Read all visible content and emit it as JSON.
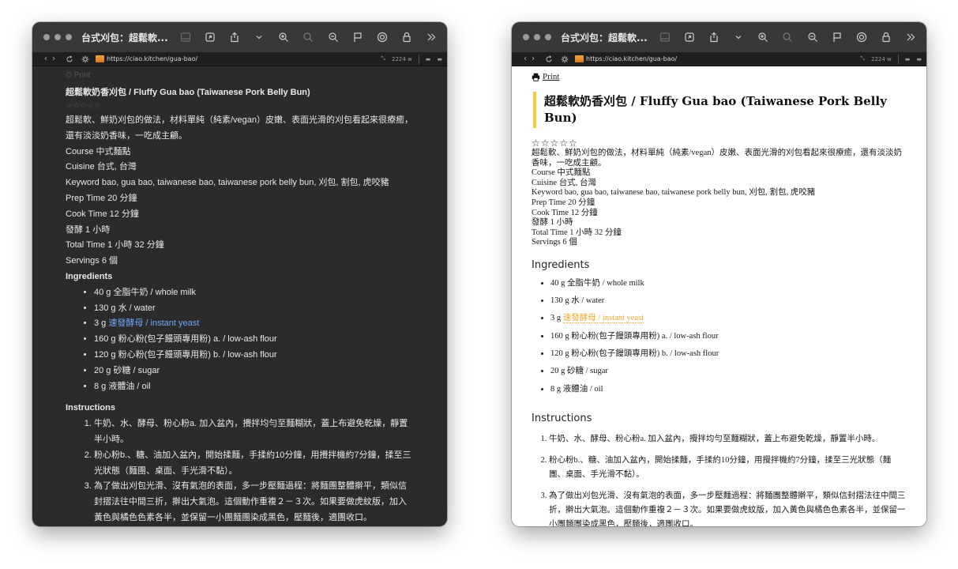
{
  "window": {
    "title": "台式刈包：超鬆軟...",
    "url": "https://ciao.kitchen/gua-bao/",
    "width_badge": "2224 w"
  },
  "recipe": {
    "print_label": "Print",
    "title_dark": "超鬆軟奶香刈包 / Fluffy Gua bao (Taiwanese Pork Belly Bun)",
    "title_light": "超鬆軟奶香刈包 / Fluffy Gua bao (Taiwanese Pork Belly Bun)",
    "stars": "☆☆☆☆☆",
    "description": "超鬆軟、鮮奶刈包的做法，材料單純（純素/vegan）皮嫩、表面光滑的刈包看起來很療癒，還有淡淡奶香味，一吃成主顧。",
    "course": "Course 中式麵點",
    "cuisine": "Cuisine 台式, 台灣",
    "keyword": "Keyword bao, gua bao, taiwanese bao, taiwanese pork belly bun, 刈包, 割包, 虎咬豬",
    "prep_time": "Prep Time 20 分鐘",
    "cook_time": "Cook Time 12 分鐘",
    "ferment": "發酵 1 小時",
    "total_time": "Total Time 1 小時 32 分鐘",
    "servings": "Servings 6 個",
    "ingredients_heading": "Ingredients",
    "ingredients": [
      {
        "pre": "40 g 全脂牛奶 / whole milk",
        "link": ""
      },
      {
        "pre": "130 g 水 / water",
        "link": ""
      },
      {
        "pre": "3 g ",
        "link": "速發酵母 / instant yeast"
      },
      {
        "pre": "160 g 粉心粉(包子饅頭專用粉) a. / low-ash flour",
        "link": ""
      },
      {
        "pre": "120 g 粉心粉(包子饅頭專用粉)  b. / low-ash flour",
        "link": ""
      },
      {
        "pre": "20 g 砂糖 / sugar",
        "link": ""
      },
      {
        "pre": "8 g 液體油 / oil",
        "link": ""
      }
    ],
    "instructions_heading": "Instructions",
    "instructions": [
      "牛奶、水、酵母、粉心粉a. 加入盆內，攪拌均勻至麵糊狀，蓋上布避免乾燥，靜置半小時。",
      "粉心粉b.、糖、油加入盆內，開始揉麵，手揉約10分鐘，用攪拌機約7分鐘，揉至三光狀態（麵團、桌面、手光滑不黏）。",
      "為了做出刈包光滑、沒有氣泡的表面，多一步壓麵過程：將麵團整體擀平，類似信封摺法往中間三折，擀出大氣泡。這個動作重複２－３次。如果要做虎紋版，加入黃色與橘色色素各半，並保留一小團麵團染成黑色，壓麵後，適團收口。"
    ]
  }
}
